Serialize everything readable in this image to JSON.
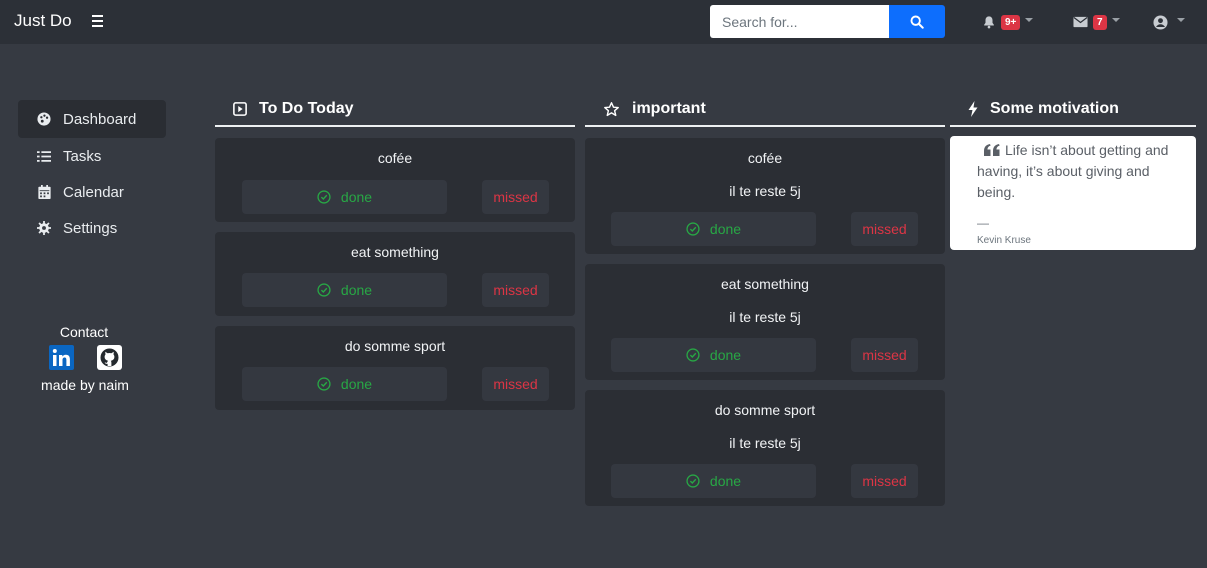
{
  "app": {
    "title": "Just Do"
  },
  "search": {
    "placeholder": "Search for..."
  },
  "nav": {
    "alerts_count": "9+",
    "messages_count": "7"
  },
  "sidebar": {
    "items": [
      {
        "label": "Dashboard",
        "icon": "palette-icon"
      },
      {
        "label": "Tasks",
        "icon": "list-icon"
      },
      {
        "label": "Calendar",
        "icon": "calendar-icon"
      },
      {
        "label": "Settings",
        "icon": "gear-icon"
      }
    ],
    "contact_label": "Contact",
    "made_by": "made by naim"
  },
  "columns": {
    "today": {
      "title": "To Do Today",
      "tasks": [
        {
          "name": "cofée",
          "done_label": "done",
          "missed_label": "missed"
        },
        {
          "name": "eat something",
          "done_label": "done",
          "missed_label": "missed"
        },
        {
          "name": "do somme sport",
          "done_label": "done",
          "missed_label": "missed"
        }
      ]
    },
    "important": {
      "title": "important",
      "tasks": [
        {
          "name": "cofée",
          "remaining": "il te reste 5j",
          "done_label": "done",
          "missed_label": "missed"
        },
        {
          "name": "eat something",
          "remaining": "il te reste 5j",
          "done_label": "done",
          "missed_label": "missed"
        },
        {
          "name": "do somme sport",
          "remaining": "il te reste 5j",
          "done_label": "done",
          "missed_label": "missed"
        }
      ]
    },
    "motivation": {
      "title": "Some motivation",
      "quote": "Life isn’t about getting and having, it’s about giving and being.",
      "dash": "—",
      "author": "Kevin Kruse"
    }
  },
  "colors": {
    "background": "#363a42",
    "topbar": "#2c3037",
    "card": "#2b2e34",
    "accent": "#0d6efd",
    "done": "#28a745",
    "missed": "#dc3545"
  }
}
